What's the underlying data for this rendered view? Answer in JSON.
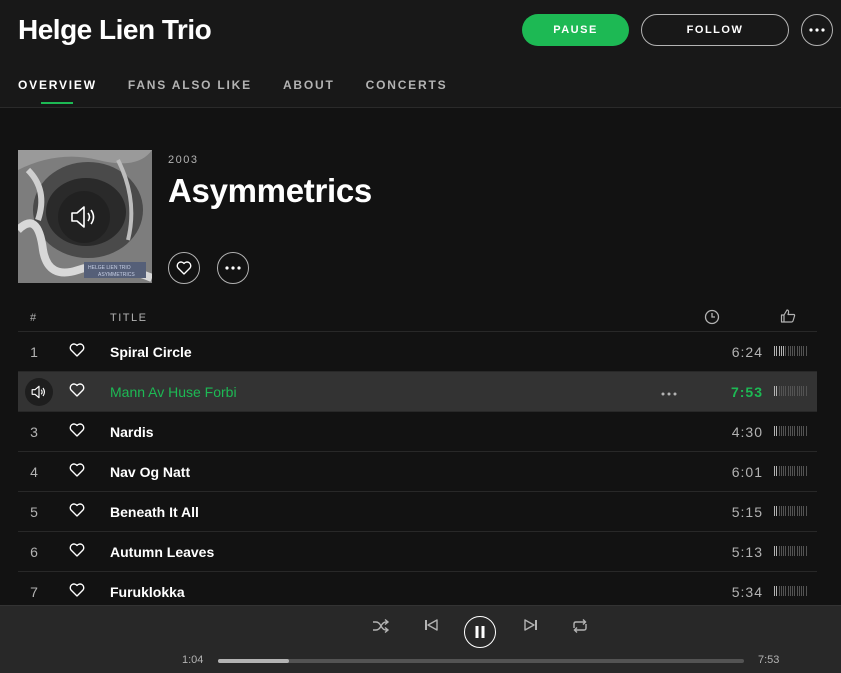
{
  "artist": {
    "name": "Helge Lien Trio"
  },
  "actions": {
    "pause_label": "PAUSE",
    "follow_label": "FOLLOW"
  },
  "tabs": [
    {
      "label": "OVERVIEW",
      "active": true
    },
    {
      "label": "FANS ALSO LIKE",
      "active": false
    },
    {
      "label": "ABOUT",
      "active": false
    },
    {
      "label": "CONCERTS",
      "active": false
    }
  ],
  "album": {
    "year": "2003",
    "title": "Asymmetrics",
    "art_text_top": "HELGE LIEN TRIO",
    "art_text_bottom": "ASYMMETRICS"
  },
  "tracklist": {
    "headers": {
      "number": "#",
      "title": "TITLE"
    },
    "tracks": [
      {
        "number": "1",
        "title": "Spiral Circle",
        "duration": "6:24",
        "popularity": 0.3,
        "playing": false
      },
      {
        "number": "2",
        "title": "Mann Av Huse Forbi",
        "duration": "7:53",
        "popularity": 0.1,
        "playing": true
      },
      {
        "number": "3",
        "title": "Nardis",
        "duration": "4:30",
        "popularity": 0.1,
        "playing": false
      },
      {
        "number": "4",
        "title": "Nav Og Natt",
        "duration": "6:01",
        "popularity": 0.1,
        "playing": false
      },
      {
        "number": "5",
        "title": "Beneath It All",
        "duration": "5:15",
        "popularity": 0.1,
        "playing": false
      },
      {
        "number": "6",
        "title": "Autumn Leaves",
        "duration": "5:13",
        "popularity": 0.1,
        "playing": false
      },
      {
        "number": "7",
        "title": "Furuklokka",
        "duration": "5:34",
        "popularity": 0.1,
        "playing": false
      }
    ]
  },
  "player": {
    "current_time": "1:04",
    "total_time": "7:53",
    "progress_fraction": 0.135
  },
  "colors": {
    "accent": "#1db954",
    "background": "#121212",
    "text_secondary": "#b3b3b3"
  }
}
